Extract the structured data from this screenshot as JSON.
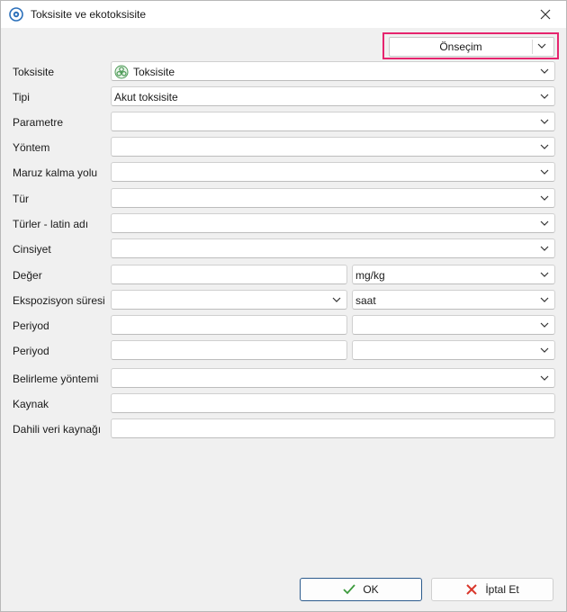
{
  "window": {
    "title": "Toksisite ve ekotoksisite"
  },
  "preset": {
    "label": "Önseçim"
  },
  "form": {
    "toksisite": {
      "label": "Toksisite",
      "value": "Toksisite"
    },
    "tipi": {
      "label": "Tipi",
      "value": "Akut toksisite"
    },
    "parametre": {
      "label": "Parametre",
      "value": ""
    },
    "yontem": {
      "label": "Yöntem",
      "value": ""
    },
    "maruz": {
      "label": "Maruz kalma yolu",
      "value": ""
    },
    "tur": {
      "label": "Tür",
      "value": ""
    },
    "turler": {
      "label": "Türler - latin adı",
      "value": ""
    },
    "cinsiyet": {
      "label": "Cinsiyet",
      "value": ""
    },
    "deger": {
      "label": "Değer",
      "value": "",
      "unit": "mg/kg"
    },
    "ekspozisyon": {
      "label": "Ekspozisyon süresi",
      "value": "",
      "unit": "saat"
    },
    "periyod1": {
      "label": "Periyod",
      "value": "",
      "unit": ""
    },
    "periyod2": {
      "label": "Periyod",
      "value": "",
      "unit": ""
    },
    "belirleme": {
      "label": "Belirleme yöntemi",
      "value": ""
    },
    "kaynak": {
      "label": "Kaynak",
      "value": ""
    },
    "dahili": {
      "label": "Dahili veri kaynağı",
      "value": ""
    }
  },
  "buttons": {
    "ok": "OK",
    "cancel": "İptal Et"
  },
  "colors": {
    "highlight": "#e6246e",
    "ok_check": "#3c9a3c",
    "cancel_x": "#d9362b"
  }
}
